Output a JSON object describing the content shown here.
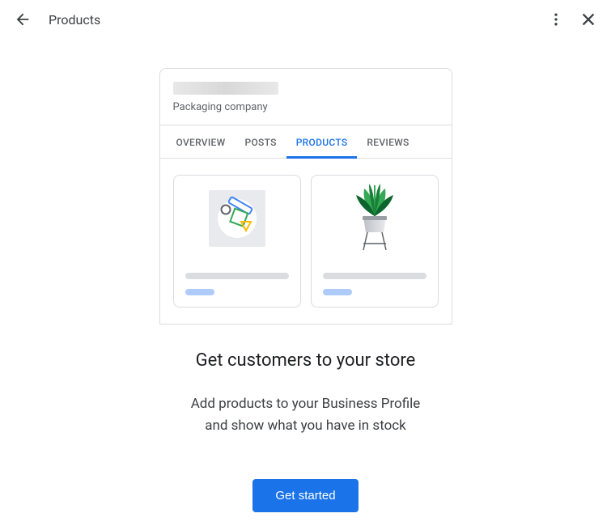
{
  "header": {
    "title": "Products"
  },
  "preview": {
    "company_type": "Packaging company",
    "tabs": [
      {
        "label": "OVERVIEW"
      },
      {
        "label": "POSTS"
      },
      {
        "label": "PRODUCTS"
      },
      {
        "label": "REVIEWS"
      }
    ]
  },
  "main": {
    "headline": "Get customers to your store",
    "subtext_line1": "Add products to your Business Profile",
    "subtext_line2": "and show what you have in stock",
    "cta_label": "Get started"
  }
}
